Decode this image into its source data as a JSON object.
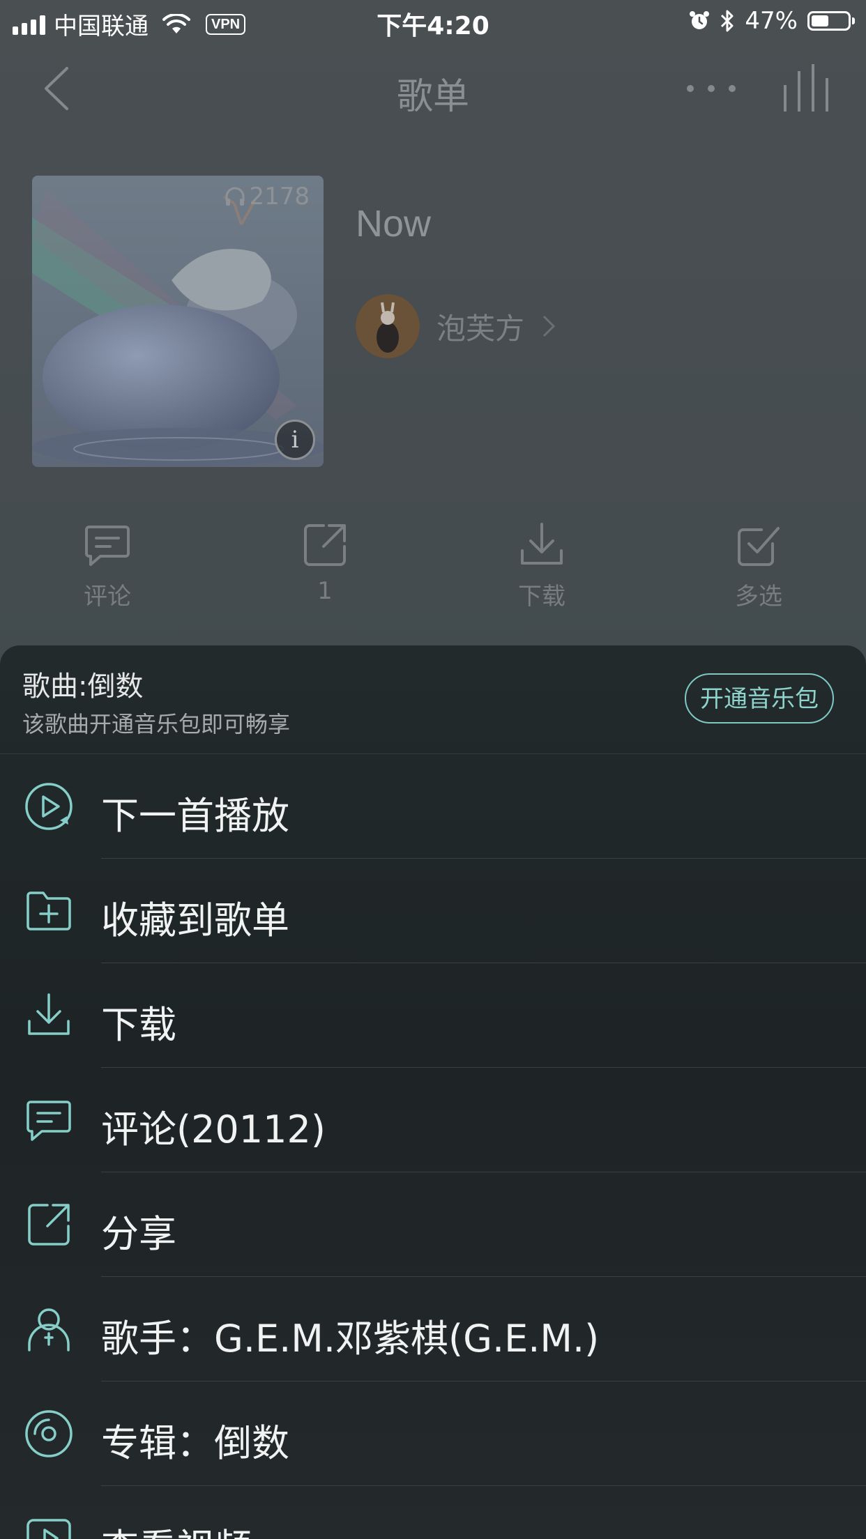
{
  "status_bar": {
    "carrier": "中国联通",
    "vpn": "VPN",
    "time": "下午4:20",
    "battery_text": "47%",
    "battery_level": 0.47,
    "icons": [
      "signal-icon",
      "wifi-icon",
      "alarm-icon",
      "bluetooth-icon",
      "battery-icon"
    ]
  },
  "nav": {
    "title": "歌单",
    "icons": [
      "back-icon",
      "more-icon",
      "equalizer-icon"
    ]
  },
  "playlist": {
    "name": "Now",
    "play_count": "2178",
    "creator": "泡芙方"
  },
  "actions": [
    {
      "label": "评论",
      "icon": "comment-icon"
    },
    {
      "label": "1",
      "icon": "share-icon"
    },
    {
      "label": "下载",
      "icon": "download-icon"
    },
    {
      "label": "多选",
      "icon": "multi-select-icon"
    }
  ],
  "sheet": {
    "song_title": "歌曲:倒数",
    "subtitle": "该歌曲开通音乐包即可畅享",
    "vip_button": "开通音乐包",
    "items": [
      {
        "label": "下一首播放",
        "icon": "play-next-icon"
      },
      {
        "label": "收藏到歌单",
        "icon": "add-to-playlist-icon"
      },
      {
        "label": "下载",
        "icon": "download-icon"
      },
      {
        "label": "评论(20112)",
        "icon": "comment-icon"
      },
      {
        "label": "分享",
        "icon": "share-icon"
      },
      {
        "label": "歌手：G.E.M.邓紫棋(G.E.M.)",
        "icon": "artist-icon"
      },
      {
        "label": "专辑：倒数",
        "icon": "album-icon"
      },
      {
        "label": "查看视频",
        "icon": "video-icon"
      }
    ]
  },
  "colors": {
    "accent": "#7fc9c4",
    "sheet_bg": "#1f2527",
    "menu_text": "#f1f2f2"
  }
}
